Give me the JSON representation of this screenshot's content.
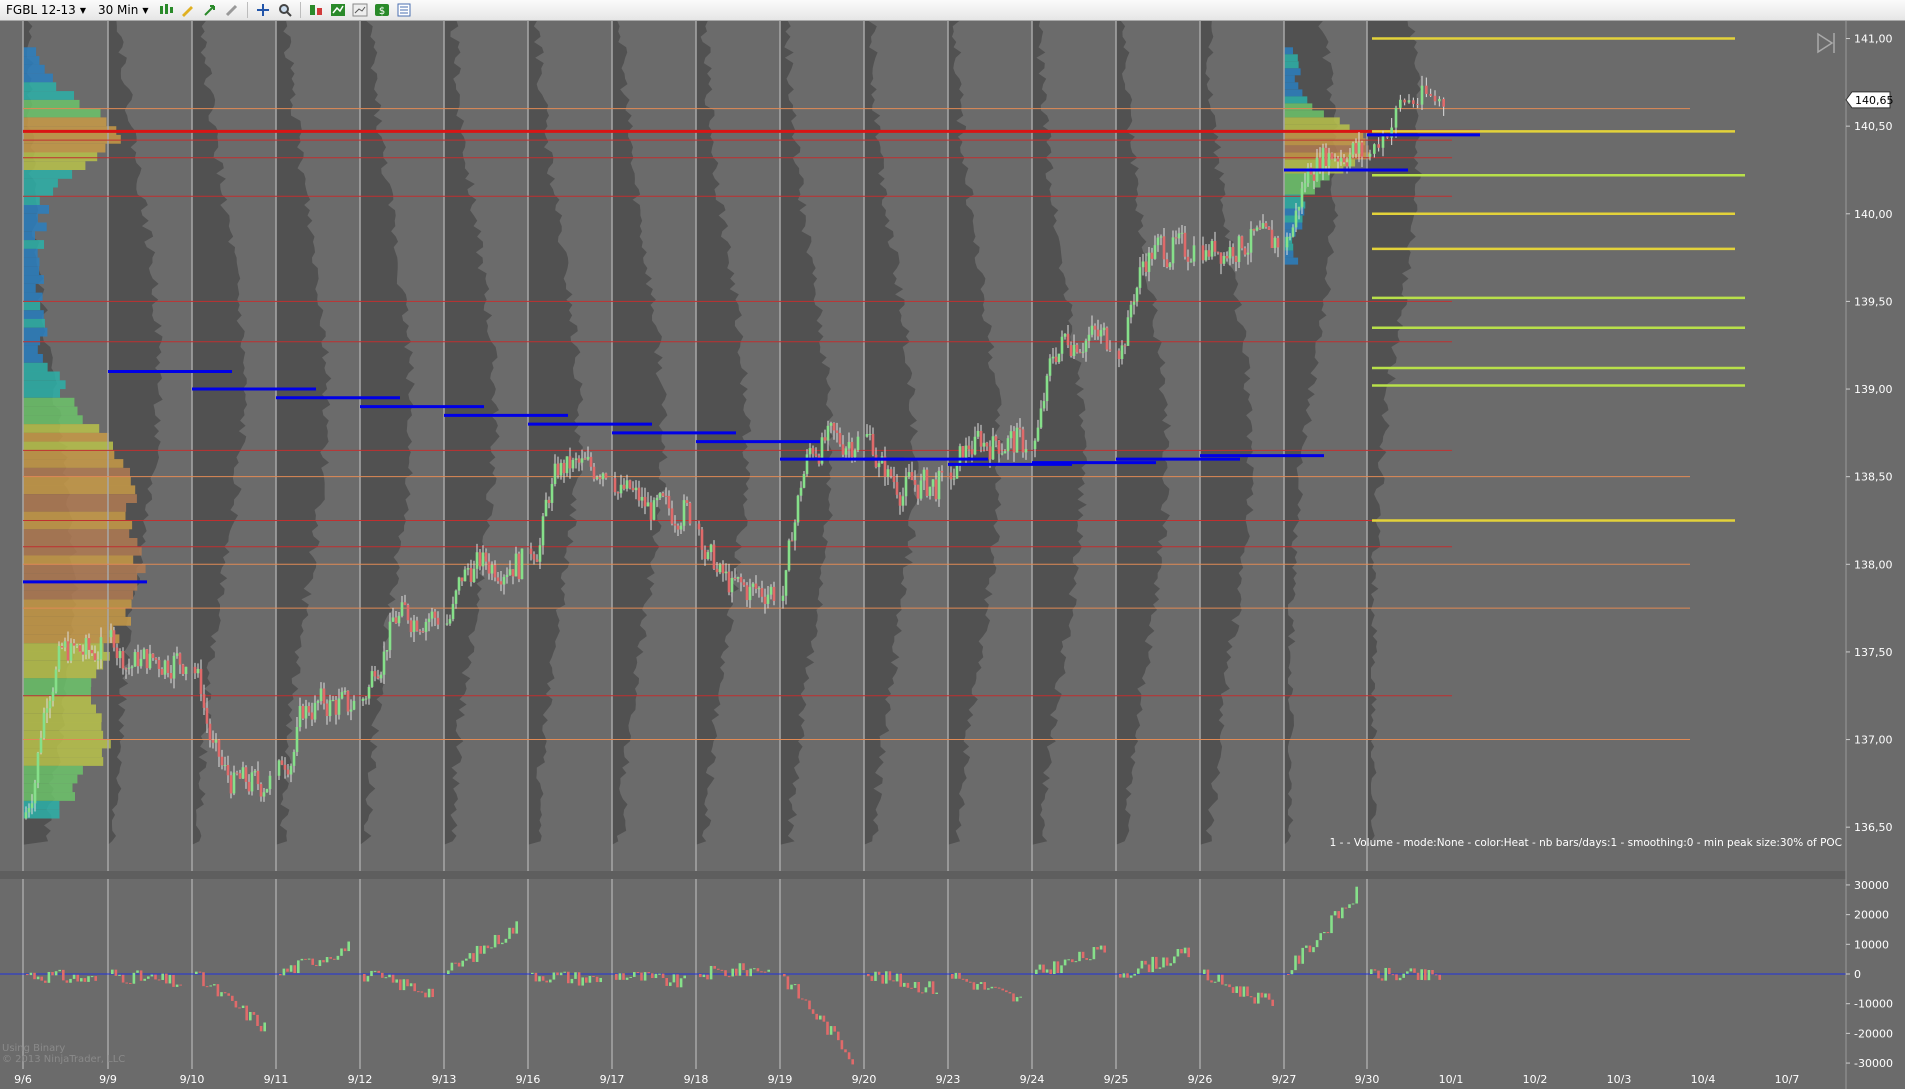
{
  "toolbar": {
    "instrument": "FGBL 12-13",
    "interval": "30 Min"
  },
  "price_axis": {
    "ticks": [
      "141,00",
      "140,50",
      "140,00",
      "139,50",
      "139,00",
      "138,50",
      "138,00",
      "137,50",
      "137,00",
      "136,50"
    ],
    "last_price": "140,65"
  },
  "indicator_axis": {
    "ticks": [
      "30000",
      "20000",
      "10000",
      "0",
      "-10000",
      "-20000",
      "-30000"
    ]
  },
  "date_axis": {
    "labels": [
      "9/6",
      "9/9",
      "9/10",
      "9/11",
      "9/12",
      "9/13",
      "9/16",
      "9/17",
      "9/18",
      "9/19",
      "9/20",
      "9/23",
      "9/24",
      "9/25",
      "9/26",
      "9/27",
      "9/30",
      "10/1",
      "10/2",
      "10/3",
      "10/4",
      "10/7"
    ]
  },
  "legend_text": "1 -  - Volume - mode:None - color:Heat - nb bars/days:1 - smoothing:0 - min peak size:30% of POC",
  "watermark": {
    "line1": "Using Binary",
    "line2": "© 2013 NinjaTrader, LLC"
  },
  "colors": {
    "background": "#6b6b6b",
    "profile": "#4c4c4c",
    "poc_line": "#0000e6",
    "major_level": "#d91414",
    "level_red": "#c03030",
    "level_orange": "#e08a55",
    "level_yellow": "#e3d23a",
    "level_lime": "#b8e04a",
    "candle_up": "#86e08a",
    "candle_down": "#e06a6a",
    "zero_line": "#2233dd"
  },
  "chart_data": {
    "type": "candlestick",
    "x": [
      "9/6",
      "9/9",
      "9/10",
      "9/11",
      "9/12",
      "9/13",
      "9/16",
      "9/17",
      "9/18",
      "9/19",
      "9/20",
      "9/23",
      "9/24",
      "9/25",
      "9/26",
      "9/27",
      "9/30"
    ],
    "close": [
      137.5,
      137.45,
      136.75,
      137.2,
      137.7,
      138.0,
      138.55,
      138.3,
      137.85,
      138.7,
      138.45,
      138.7,
      139.3,
      139.8,
      139.85,
      140.35,
      140.65
    ],
    "session_poc": [
      137.9,
      139.1,
      139.0,
      138.95,
      138.9,
      138.85,
      138.8,
      138.75,
      138.7,
      138.6,
      138.6,
      138.57,
      138.58,
      138.6,
      138.62,
      140.25,
      140.45
    ],
    "key_levels": {
      "major": [
        140.47
      ],
      "red": [
        140.42,
        140.32,
        140.1,
        139.5,
        139.27,
        138.65,
        138.25,
        138.1,
        137.25
      ],
      "orange": [
        140.6,
        138.5,
        138.0,
        137.75,
        137.0
      ],
      "yellow": [
        141.0,
        140.47,
        140.0,
        139.8,
        138.25
      ],
      "lime": [
        140.22,
        139.52,
        139.35,
        139.12,
        139.02
      ]
    },
    "ylim": [
      136.25,
      141.1
    ],
    "indicator": {
      "x": [
        "9/6",
        "9/9",
        "9/10",
        "9/11",
        "9/12",
        "9/13",
        "9/16",
        "9/17",
        "9/18",
        "9/19",
        "9/20",
        "9/23",
        "9/24",
        "9/25",
        "9/26",
        "9/27",
        "9/30"
      ],
      "values": [
        -2000,
        -3000,
        -18000,
        9000,
        -6000,
        16000,
        -2000,
        -3000,
        2000,
        -28000,
        -5000,
        -9000,
        8000,
        7000,
        -10000,
        27000,
        -1000
      ],
      "ylim": [
        -32000,
        32000
      ]
    }
  }
}
